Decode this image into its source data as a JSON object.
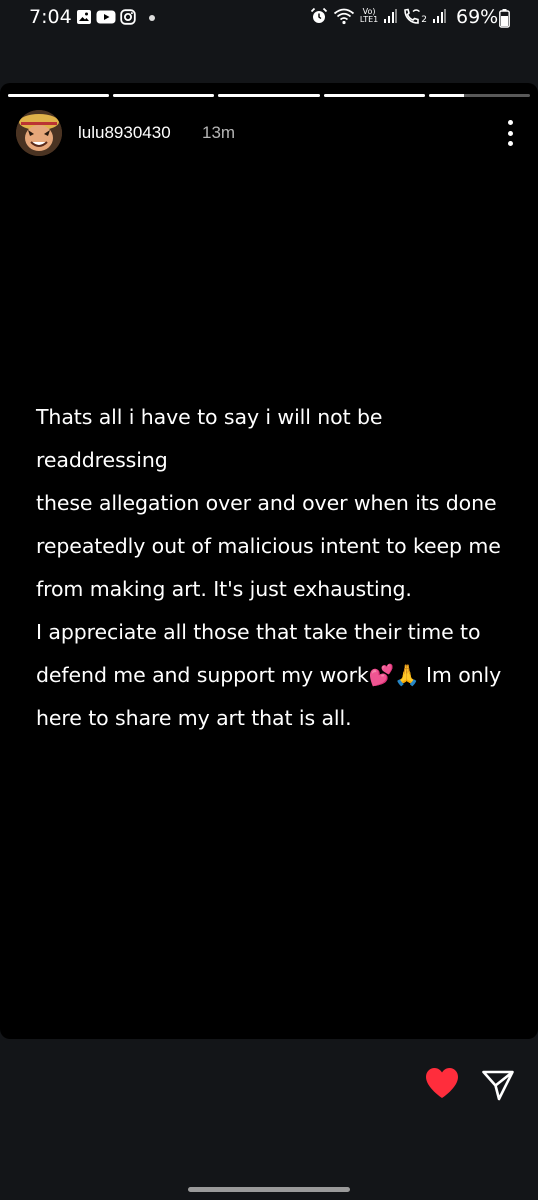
{
  "status_bar": {
    "time": "7:04",
    "battery_percent": "69%",
    "network_label": "LTE1",
    "volte_label": "Vo)",
    "sim2_label": "2",
    "notification_icons": [
      "gallery-icon",
      "youtube-icon",
      "instagram-icon"
    ],
    "system_icons": [
      "alarm-icon",
      "wifi-icon",
      "signal-icon",
      "wifi-calling-icon",
      "signal-icon",
      "battery-icon"
    ]
  },
  "story": {
    "segments": [
      1,
      1,
      1,
      1,
      0.35
    ],
    "username": "lulu8930430",
    "time_ago": "13m",
    "lines": [
      "Thats all i have to say i will not be readdressing",
      "these allegation over and over when its done",
      "repeatedly out of malicious intent to keep me",
      "from making art. It's just exhausting.",
      "I appreciate all those that take their time to",
      "defend me and support my work💕🙏 Im only",
      "here to share my art that is all."
    ]
  },
  "actions": {
    "heart_color": "#ff2d3c",
    "liked": true
  }
}
